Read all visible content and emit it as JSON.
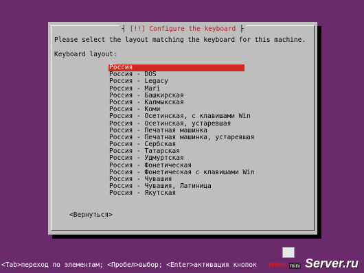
{
  "dialog": {
    "title_left": "[!!]",
    "title_text": "Configure the keyboard",
    "prompt": "Please select the layout matching the keyboard for this machine.",
    "field_label": "Keyboard layout:",
    "options": [
      "Россия",
      "Россия - DOS",
      "Россия - Legacy",
      "Россия - Mari",
      "Россия - Башкирская",
      "Россия - Калмыкская",
      "Россия - Коми",
      "Россия - Осетинская, с клавишами Win",
      "Россия - Осетинская, устаревшая",
      "Россия - Печатная машинка",
      "Россия - Печатная машинка, устаревшая",
      "Россия - Сербская",
      "Россия - Татарская",
      "Россия - Удмуртская",
      "Россия - Фонетическая",
      "Россия - Фонетическая с клавишами Win",
      "Россия - Чувашия",
      "Россия - Чувашия, Латиница",
      "Россия - Якутская"
    ],
    "selected_index": 0,
    "back_button": "<Вернуться>"
  },
  "statusbar": {
    "text": "<Tab>переход по элементам; <Пробел>выбор; <Enter>активация кнопок"
  },
  "watermark": {
    "www": "www.",
    "mini": "mini",
    "main": "Server.ru"
  },
  "colors": {
    "background": "#6b2a6b",
    "dialog": "#bebebe",
    "selection": "#d0281e",
    "title": "#b11a1a"
  }
}
